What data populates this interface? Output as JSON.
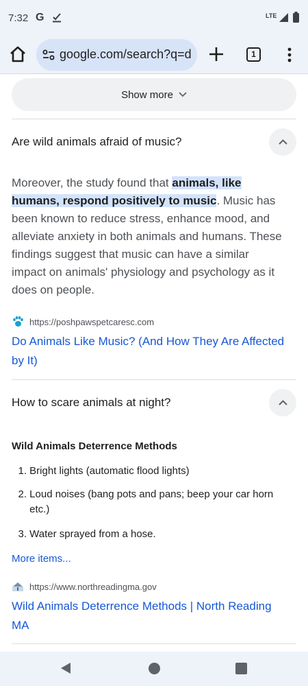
{
  "status_bar": {
    "time": "7:32",
    "g_label": "G",
    "network": "LTE"
  },
  "toolbar": {
    "url": "google.com/search?q=d",
    "tab_count": "1"
  },
  "content": {
    "show_more_label": "Show more",
    "faq1": {
      "question": "Are wild animals afraid of music?",
      "answer_lines": [
        "Moreover, the study found that ",
        "animals, like",
        "humans, respond positively to music",
        ". Music has",
        "been known to reduce stress, enhance mood, and",
        "alleviate anxiety in both animals and humans. These",
        "findings suggest that music can have a similar",
        "impact on animals' physiology and psychology as it",
        "does on people."
      ],
      "source_url": "https://poshpawspetcaresc.com",
      "link_line1": "Do Animals Like Music? (And How They Are Affected",
      "link_line2": "by It)"
    },
    "faq2": {
      "question": "How to scare animals at night?",
      "list_title": "Wild Animals Deterrence Methods",
      "items": [
        {
          "num": "1.",
          "text": "Bright lights (automatic flood lights)"
        },
        {
          "num": "2.",
          "text_line1": "Loud noises (bang pots and pans; beep your car horn",
          "text_line2": "etc.)"
        },
        {
          "num": "3.",
          "text": "Water sprayed from a hose."
        }
      ],
      "more_items": "More items...",
      "source_url": "https://www.northreadingma.gov",
      "link_line1": "Wild Animals Deterrence Methods | North Reading",
      "link_line2": "MA"
    }
  },
  "colors": {
    "chrome_bg": "#eef2f9",
    "url_pill": "#d7e3f7",
    "link": "#1558d6",
    "highlight": "#d3e3fd",
    "favicon_paw": "#1a9fd0"
  }
}
